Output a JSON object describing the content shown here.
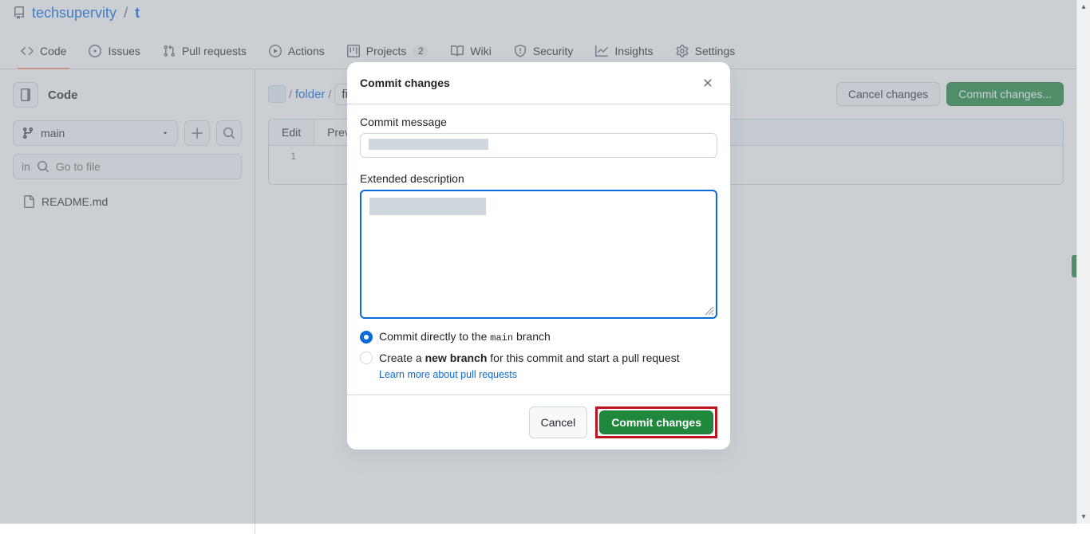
{
  "repo": {
    "owner": "techsupervity",
    "name": "t"
  },
  "tabs": [
    {
      "label": "Code",
      "active": true
    },
    {
      "label": "Issues"
    },
    {
      "label": "Pull requests"
    },
    {
      "label": "Actions"
    },
    {
      "label": "Projects",
      "count": "2"
    },
    {
      "label": "Wiki"
    },
    {
      "label": "Security"
    },
    {
      "label": "Insights"
    },
    {
      "label": "Settings"
    }
  ],
  "sidebar": {
    "title": "Code",
    "branch": "main",
    "file_filter_placeholder": "Go to file",
    "files": [
      {
        "name": "README.md"
      }
    ]
  },
  "editor": {
    "path_folder": "folder",
    "filename_partial": "fi",
    "cancel_label": "Cancel changes",
    "commit_label": "Commit changes...",
    "tab_edit": "Edit",
    "tab_preview": "Preview",
    "line_number": "1"
  },
  "modal": {
    "title": "Commit changes",
    "commit_message_label": "Commit message",
    "extended_label": "Extended description",
    "radio_direct_prefix": "Commit directly to the ",
    "radio_direct_branch": "main",
    "radio_direct_suffix": " branch",
    "radio_newbranch_prefix": "Create a ",
    "radio_newbranch_bold": "new branch",
    "radio_newbranch_suffix": " for this commit and start a pull request",
    "learn_link": "Learn more about pull requests",
    "cancel": "Cancel",
    "commit": "Commit changes"
  }
}
